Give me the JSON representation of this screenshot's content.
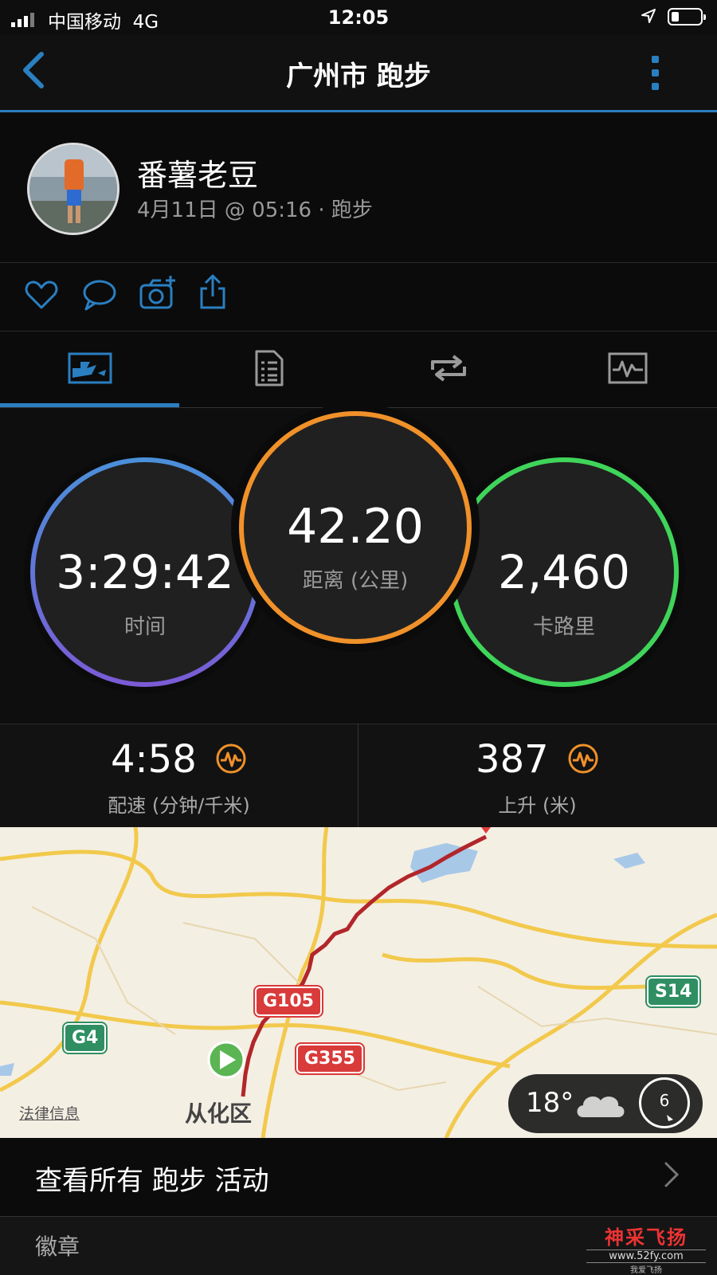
{
  "status_bar": {
    "carrier": "中国移动",
    "network": "4G",
    "time": "12:05"
  },
  "nav": {
    "title": "广州市 跑步"
  },
  "profile": {
    "name": "番薯老豆",
    "meta": "4月11日 @ 05:16 · 跑步"
  },
  "actions": [
    "heart-icon",
    "comment-icon",
    "camera-add-icon",
    "share-icon"
  ],
  "tabs": [
    {
      "icon": "summary-icon",
      "active": true
    },
    {
      "icon": "details-icon",
      "active": false
    },
    {
      "icon": "laps-icon",
      "active": false
    },
    {
      "icon": "charts-icon",
      "active": false
    }
  ],
  "stats": {
    "time": {
      "value": "3:29:42",
      "label": "时间"
    },
    "distance": {
      "value": "42.20",
      "label": "距离 (公里)"
    },
    "calories": {
      "value": "2,460",
      "label": "卡路里"
    }
  },
  "metrics": {
    "pace": {
      "value": "4:58",
      "label": "配速 (分钟/千米)"
    },
    "ascent": {
      "value": "387",
      "label": "上升 (米)"
    }
  },
  "map": {
    "shields": {
      "g105": "G105",
      "g355": "G355",
      "g4": "G4",
      "s14": "S14"
    },
    "legal": "法律信息",
    "district": "从化区",
    "weather": {
      "temp": "18°",
      "dial": "6"
    }
  },
  "view_all": "查看所有 跑步 活动",
  "badges": "徽章",
  "watermark": {
    "line1": "神采飞扬",
    "line2": "www.52fy.com",
    "line3": "我爱飞扬"
  },
  "colors": {
    "accent": "#2a7fc1",
    "distance_ring": "#f0912a",
    "time_ring_top": "#4a90d9",
    "time_ring_bottom": "#7b5bd6",
    "calories_ring": "#3fd45a",
    "route": "#b2262a"
  }
}
